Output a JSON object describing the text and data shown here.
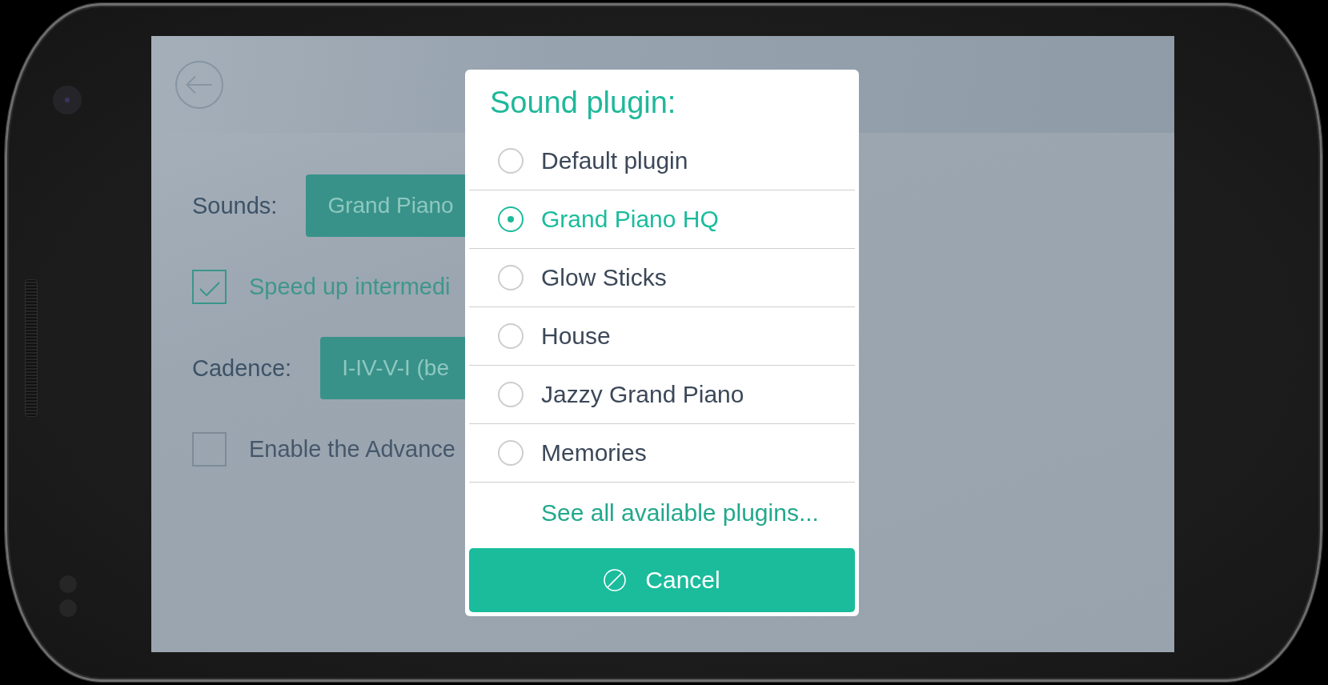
{
  "settings": [
    {
      "kind": "dropdown",
      "label": "Sounds:",
      "value": "Grand Piano"
    },
    {
      "kind": "checkbox",
      "label": "Speed up intermedi",
      "checked": true
    },
    {
      "kind": "dropdown",
      "label": "Cadence:",
      "value": "I-IV-V-I (be"
    },
    {
      "kind": "checkbox",
      "label": "Enable the Advance",
      "checked": false
    }
  ],
  "dialog": {
    "title": "Sound plugin:",
    "options": [
      {
        "label": "Default plugin",
        "selected": false
      },
      {
        "label": "Grand Piano HQ",
        "selected": true
      },
      {
        "label": "Glow Sticks",
        "selected": false
      },
      {
        "label": "House",
        "selected": false
      },
      {
        "label": "Jazzy Grand Piano",
        "selected": false
      },
      {
        "label": "Memories",
        "selected": false
      }
    ],
    "link": "See all available plugins...",
    "cancel_button": "Cancel"
  }
}
